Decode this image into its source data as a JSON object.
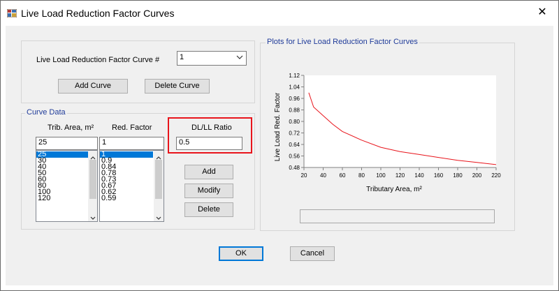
{
  "window": {
    "title": "Live Load Reduction Factor Curves",
    "close_glyph": "✕"
  },
  "curve_select": {
    "label": "Live Load Reduction Factor Curve #",
    "value": "1"
  },
  "buttons": {
    "add_curve": "Add Curve",
    "delete_curve": "Delete Curve",
    "add": "Add",
    "modify": "Modify",
    "delete": "Delete",
    "ok": "OK",
    "cancel": "Cancel"
  },
  "curve_data": {
    "group_label": "Curve Data",
    "trib_header": "Trib. Area, m²",
    "red_header": "Red. Factor",
    "trib_input": "25",
    "red_input": "1",
    "trib_list": [
      "25",
      "30",
      "40",
      "50",
      "60",
      "80",
      "100",
      "120"
    ],
    "red_list": [
      "1",
      "0.9",
      "0.84",
      "0.78",
      "0.73",
      "0.67",
      "0.62",
      "0.59"
    ],
    "selected_index": 0
  },
  "dl_ll": {
    "header": "DL/LL Ratio",
    "value": "0.5"
  },
  "plot_group_label": "Plots for Live Load Reduction Factor Curves",
  "colors": {
    "highlight": "#e8141b",
    "curve": "#e8141b",
    "group_label": "#1f3b99",
    "selection": "#0078d7"
  },
  "chart_data": {
    "type": "line",
    "xlabel": "Tributary Area, m²",
    "ylabel": "Live Load Red. Factor",
    "xlim": [
      20,
      220
    ],
    "ylim": [
      0.48,
      1.12
    ],
    "x_ticks": [
      20,
      40,
      60,
      80,
      100,
      120,
      140,
      160,
      180,
      200,
      220
    ],
    "y_ticks": [
      "0.48",
      "0.56",
      "0.64",
      "0.72",
      "0.80",
      "0.88",
      "0.96",
      "1.04",
      "1.12"
    ],
    "grid": false,
    "x": [
      25,
      30,
      40,
      50,
      60,
      80,
      100,
      120,
      140,
      160,
      180,
      200,
      220
    ],
    "y": [
      1.0,
      0.9,
      0.84,
      0.78,
      0.73,
      0.67,
      0.62,
      0.59,
      0.57,
      0.55,
      0.53,
      0.515,
      0.5
    ]
  }
}
